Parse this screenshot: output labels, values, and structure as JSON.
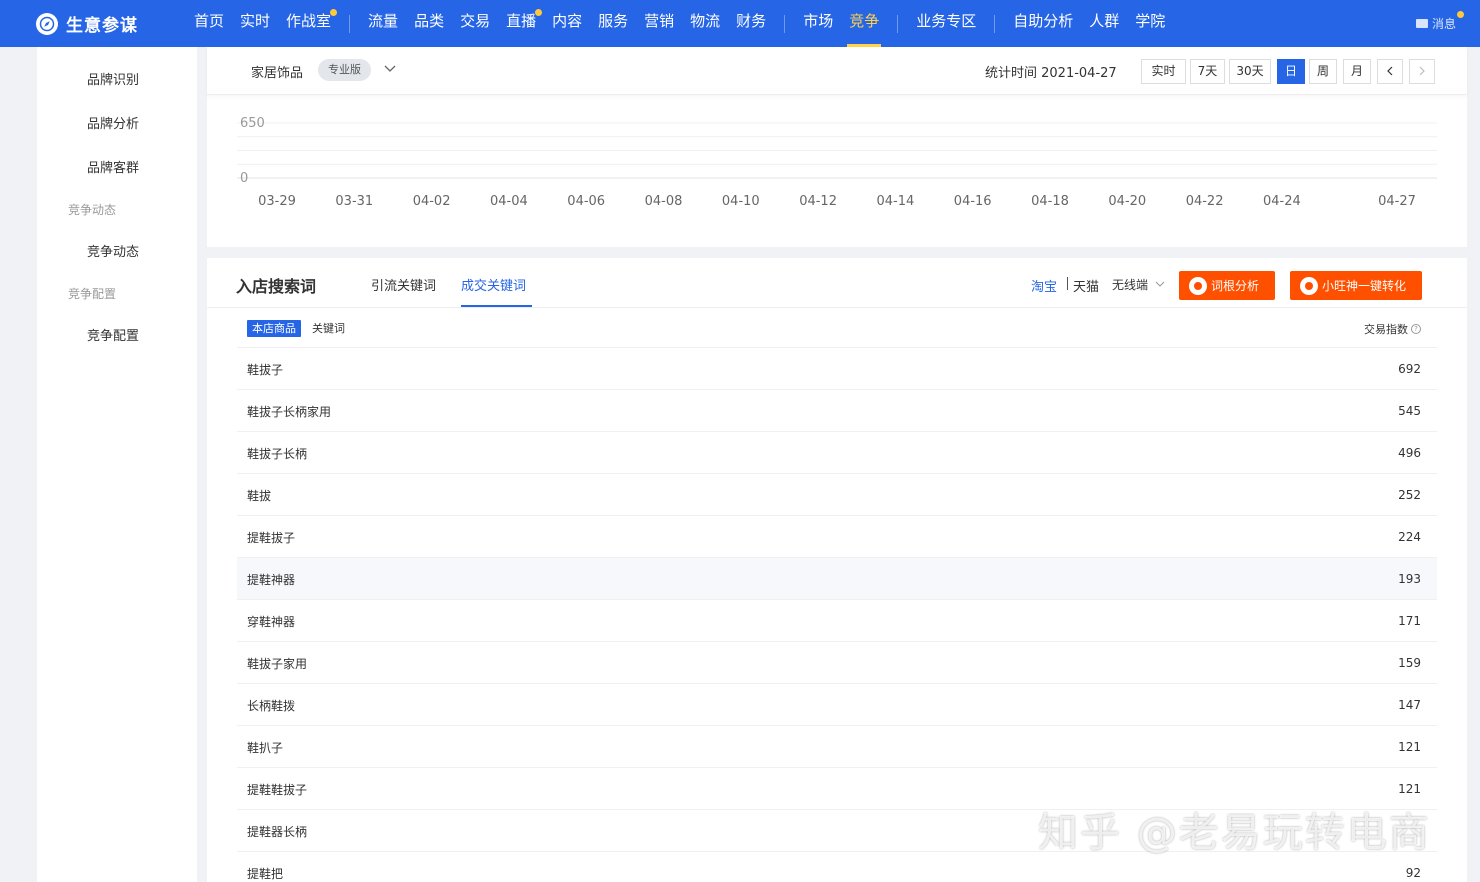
{
  "app": {
    "title": "生意参谋"
  },
  "nav": {
    "items": [
      {
        "label": "首页"
      },
      {
        "label": "实时"
      },
      {
        "label": "作战室",
        "dot": true
      },
      {
        "label": "流量"
      },
      {
        "label": "品类"
      },
      {
        "label": "交易"
      },
      {
        "label": "直播",
        "dot": true
      },
      {
        "label": "内容"
      },
      {
        "label": "服务"
      },
      {
        "label": "营销"
      },
      {
        "label": "物流"
      },
      {
        "label": "财务"
      },
      {
        "label": "市场"
      },
      {
        "label": "竞争",
        "active": true
      },
      {
        "label": "业务专区"
      },
      {
        "label": "自助分析"
      },
      {
        "label": "人群"
      },
      {
        "label": "学院"
      }
    ],
    "message_label": "消息"
  },
  "sidebar": {
    "items": [
      "品牌识别",
      "品牌分析",
      "品牌客群"
    ],
    "group1": "竞争动态",
    "group1_items": [
      "竞争动态"
    ],
    "group2": "竞争配置",
    "group2_items": [
      "竞争配置"
    ]
  },
  "filter": {
    "category": "家居饰品",
    "edition_badge": "专业版",
    "stat_time": "统计时间 2021-04-27",
    "time_buttons": [
      "实时",
      "7天",
      "30天",
      "日",
      "周",
      "月"
    ],
    "active_time_button": "日"
  },
  "chart_data": {
    "type": "line",
    "y_ticks": [
      650,
      0
    ],
    "ylim": [
      0,
      650
    ],
    "x_ticks": [
      "03-29",
      "03-31",
      "04-02",
      "04-04",
      "04-06",
      "04-08",
      "04-10",
      "04-12",
      "04-14",
      "04-16",
      "04-18",
      "04-20",
      "04-22",
      "04-24",
      "04-27"
    ],
    "series": [],
    "grid": true
  },
  "keywords_panel": {
    "title": "入店搜索词",
    "tabs": [
      "引流关键词",
      "成交关键词"
    ],
    "active_tab": "成交关键词",
    "platforms": [
      "淘宝",
      "天猫"
    ],
    "active_platform": "淘宝",
    "device": "无线端",
    "button_root_analysis": "词根分析",
    "button_xiaowang": "小旺神一键转化",
    "chip_active": "本店商品",
    "chip_keyword": "关键词",
    "column_metric": "交易指数",
    "rows": [
      {
        "keyword": "鞋拔子",
        "value": "692"
      },
      {
        "keyword": "鞋拔子长柄家用",
        "value": "545"
      },
      {
        "keyword": "鞋拔子长柄",
        "value": "496"
      },
      {
        "keyword": "鞋拔",
        "value": "252"
      },
      {
        "keyword": "提鞋拔子",
        "value": "224"
      },
      {
        "keyword": "提鞋神器",
        "value": "193"
      },
      {
        "keyword": "穿鞋神器",
        "value": "171"
      },
      {
        "keyword": "鞋拔子家用",
        "value": "159"
      },
      {
        "keyword": "长柄鞋拨",
        "value": "147"
      },
      {
        "keyword": "鞋扒子",
        "value": "121"
      },
      {
        "keyword": "提鞋鞋拔子",
        "value": "121"
      },
      {
        "keyword": "提鞋器长柄",
        "value": ""
      },
      {
        "keyword": "提鞋把",
        "value": "92"
      }
    ],
    "highlighted_row": 5
  },
  "watermark": "知乎 @老易玩转电商",
  "colors": {
    "brand_blue": "#2565e6",
    "accent_orange": "#ff5000",
    "nav_active": "#ffd24a"
  }
}
